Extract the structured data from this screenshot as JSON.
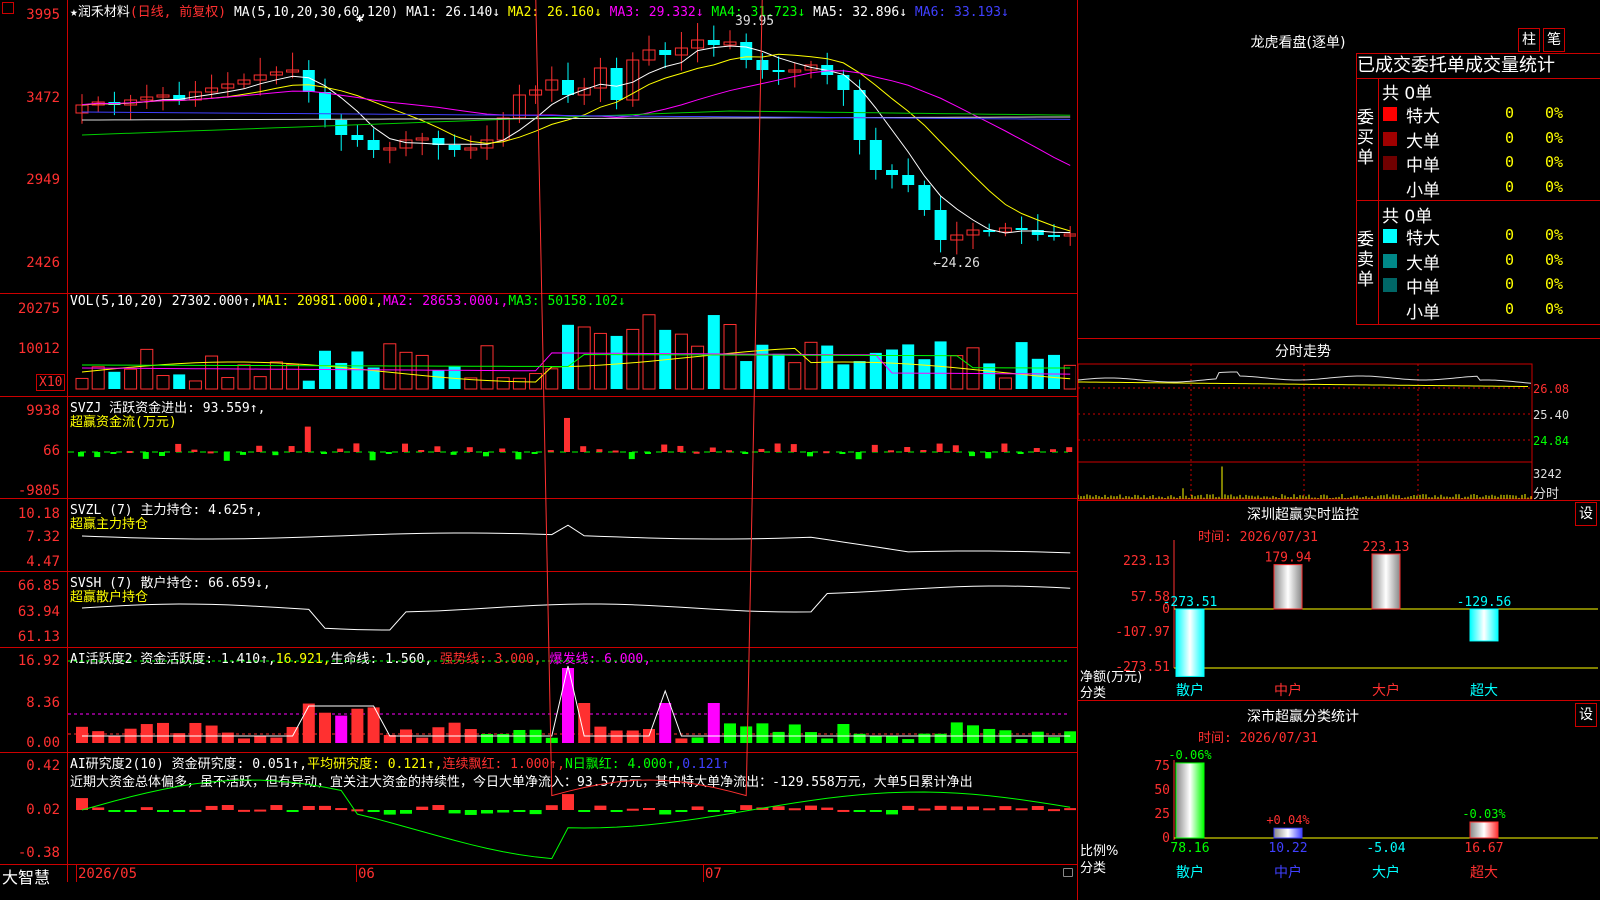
{
  "main": {
    "ticker": "★润禾材料",
    "period": "(日线, 前复权)",
    "ma_label": "MA(5,10,20,30,60,120)",
    "ma": [
      {
        "text": "MA1: 26.140↓",
        "color": "#ffffff"
      },
      {
        "text": "MA2: 26.160↓",
        "color": "#ffff00"
      },
      {
        "text": "MA3: 29.332↓",
        "color": "#ff00ff"
      },
      {
        "text": "MA4: 31.723↓",
        "color": "#00ff00"
      },
      {
        "text": "MA5: 32.896↓",
        "color": "#ffffff"
      },
      {
        "text": "MA6: 33.193↓",
        "color": "#4040ff"
      }
    ],
    "yticks": [
      "3995",
      "3472",
      "2949",
      "2426"
    ],
    "high_label": "39.95",
    "low_label": "←24.26"
  },
  "vol": {
    "label": "VOL(5,10,20)",
    "value": "27302.000↑,",
    "ma1": "MA1: 20981.000↓,",
    "ma2": "MA2: 28653.000↓,",
    "ma3": "MA3: 50158.102↓",
    "yticks": [
      "20275",
      "10012"
    ],
    "unit": "X10"
  },
  "svzj": {
    "label": "SVZJ  活跃资金进出: 93.559↑,",
    "sub": "超赢资金流(万元)",
    "yticks": [
      "9938",
      "66",
      "-9805"
    ]
  },
  "svzl": {
    "label": "SVZL (7) 主力持仓: 4.625↑,",
    "sub": "超赢主力持仓",
    "yticks": [
      "10.18",
      "7.32",
      "4.47"
    ]
  },
  "svsh": {
    "label": "SVSH (7) 散户持仓: 66.659↓,",
    "sub": "超赢散户持仓",
    "yticks": [
      "66.85",
      "63.94",
      "61.13"
    ]
  },
  "ai1": {
    "label": "AI活跃度2 资金活跃度: 1.410↑,",
    "v2": "16.921,",
    "v3": "生命线: 1.560,",
    "v4": "强势线: 3.000,",
    "v5": "爆发线: 6.000,",
    "yticks": [
      "16.92",
      "8.36",
      "0.00"
    ]
  },
  "ai2": {
    "label": "AI研究度2(10) 资金研究度: 0.051↑,",
    "avg": "平均研究度: 0.121↑,",
    "lianxu": "连续飘红: 1.000↑,",
    "nri": "N日飘红: 4.000↑,",
    "last": "0.121↑",
    "yticks": [
      "0.42",
      "0.02",
      "-0.38"
    ],
    "commentary": "近期大资金总体偏多，虽不活跃，但有异动，宜关注大资金的持续性，今日大单净流入：93.57万元，其中特大单净流出：-129.558万元，大单5日累计净出"
  },
  "timeline": {
    "brand": "大智慧",
    "labels": [
      "2026/05",
      "06",
      "07"
    ]
  },
  "dragon": {
    "title": "龙虎看盘(逐单)",
    "btn1": "柱",
    "btn2": "笔",
    "header": "已成交委托单成交量统计",
    "buy_side": "委买单",
    "sell_side": "委卖单",
    "buy_total": "共 0单",
    "sell_total": "共 0单",
    "buy_rows": [
      {
        "name": "特大",
        "count": "0",
        "pct": "0%",
        "color": "#ff0000"
      },
      {
        "name": "大单",
        "count": "0",
        "pct": "0%",
        "color": "#a00000"
      },
      {
        "name": "中单",
        "count": "0",
        "pct": "0%",
        "color": "#700000"
      },
      {
        "name": "小单",
        "count": "0",
        "pct": "0%",
        "color": "#000000"
      }
    ],
    "sell_rows": [
      {
        "name": "特大",
        "count": "0",
        "pct": "0%",
        "color": "#00ffff"
      },
      {
        "name": "大单",
        "count": "0",
        "pct": "0%",
        "color": "#008888"
      },
      {
        "name": "中单",
        "count": "0",
        "pct": "0%",
        "color": "#006666"
      },
      {
        "name": "小单",
        "count": "0",
        "pct": "0%",
        "color": "#000000"
      }
    ]
  },
  "intraday": {
    "title": "分时走势",
    "yticks": [
      "26.08",
      "25.40",
      "24.84"
    ],
    "vol": "3242",
    "unit": "分时"
  },
  "monitor": {
    "title": "深圳超赢实时监控",
    "btn": "设",
    "time": "时间: 2026/07/31",
    "yticks": [
      "223.13",
      "57.58",
      "0",
      "-107.97",
      "-273.51"
    ],
    "axis_label": "净额(万元)",
    "axis_sub": "分类",
    "bars": [
      {
        "cat": "散户",
        "value": "-273.51",
        "v": -273.51
      },
      {
        "cat": "中户",
        "value": "179.94",
        "v": 179.94
      },
      {
        "cat": "大户",
        "value": "223.13",
        "v": 223.13
      },
      {
        "cat": "超大",
        "value": "-129.56",
        "v": -129.56
      }
    ]
  },
  "classify": {
    "title": "深市超赢分类统计",
    "btn": "设",
    "time": "时间: 2026/07/31",
    "yticks": [
      "75",
      "50",
      "25",
      "0"
    ],
    "axis_label": "比例%",
    "axis_sub": "分类",
    "bars": [
      {
        "cat": "散户",
        "top": "-0.06%",
        "bottom": "78.16",
        "v": 78.16
      },
      {
        "cat": "中户",
        "top": "+0.04%",
        "bottom": "10.22",
        "v": 10.22
      },
      {
        "cat": "大户",
        "top": "",
        "bottom": "-5.04",
        "v": -5.04
      },
      {
        "cat": "超大",
        "top": "-0.03%",
        "bottom": "16.67",
        "v": 16.67
      }
    ]
  },
  "chart_data": {
    "type": "bar",
    "title": "深圳超赢实时监控",
    "categories": [
      "散户",
      "中户",
      "大户",
      "超大"
    ],
    "series": [
      {
        "name": "净额(万元)",
        "values": [
          -273.51,
          179.94,
          223.13,
          -129.56
        ]
      }
    ]
  }
}
